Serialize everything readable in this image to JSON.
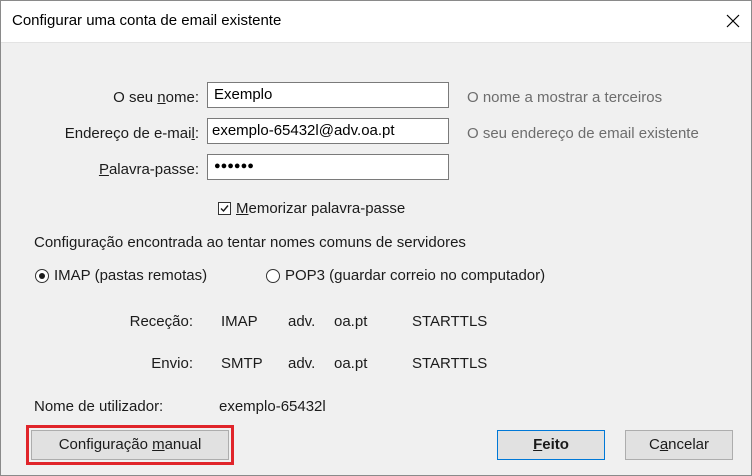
{
  "window": {
    "title": "Configurar uma conta de email existente"
  },
  "form": {
    "name_label_pre": "O seu ",
    "name_label_u": "n",
    "name_label_post": "ome:",
    "name_value": "Exemplo",
    "name_hint": "O nome a mostrar a terceiros",
    "email_label_pre": "Endereço de e-mai",
    "email_label_u": "l",
    "email_label_post": ":",
    "email_value": "exemplo-65432l@adv.oa.pt",
    "email_hint": "O seu endereço de email existente",
    "password_label_u": "P",
    "password_label_post": "alavra-passe:",
    "password_value": "●●●●●●",
    "remember_label_u": "M",
    "remember_label_post": "emorizar palavra-passe",
    "remember_checked": true
  },
  "config": {
    "status": "Configuração encontrada ao tentar nomes comuns de servidores",
    "imap_label": "IMAP (pastas remotas)",
    "pop3_label": "POP3 (guardar correio no computador)",
    "selected_protocol": "imap",
    "incoming": {
      "label": "Receção:",
      "protocol": "IMAP",
      "host_a": "adv.",
      "host_b": "oa.pt",
      "security": "STARTTLS"
    },
    "outgoing": {
      "label": "Envio:",
      "protocol": "SMTP",
      "host_a": "adv.",
      "host_b": "oa.pt",
      "security": "STARTTLS"
    },
    "username_label": "Nome de utilizador:",
    "username_value": "exemplo-65432l"
  },
  "buttons": {
    "manual_pre": "Configuração ",
    "manual_u": "m",
    "manual_post": "anual",
    "done_u": "F",
    "done_post": "eito",
    "cancel_pre": "C",
    "cancel_u": "a",
    "cancel_post": "ncelar"
  },
  "colors": {
    "highlight": "#e0252a",
    "hint_text": "#6d6d6d",
    "primary_border": "#0078d7"
  },
  "icons": {
    "close": "close-icon",
    "check": "checkmark-icon"
  }
}
